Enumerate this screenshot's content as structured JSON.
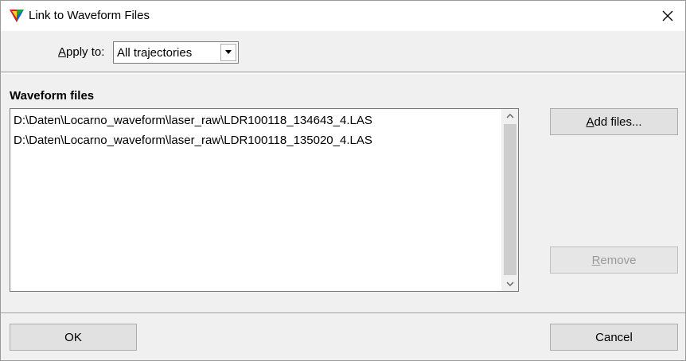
{
  "window": {
    "title": "Link to Waveform Files"
  },
  "apply": {
    "label_prefix": "",
    "label_accel": "A",
    "label_rest": "pply to:",
    "selected": "All trajectories"
  },
  "files": {
    "section_label": "Waveform files",
    "items": [
      "D:\\Daten\\Locarno_waveform\\laser_raw\\LDR100118_134643_4.LAS",
      "D:\\Daten\\Locarno_waveform\\laser_raw\\LDR100118_135020_4.LAS"
    ]
  },
  "buttons": {
    "add_accel": "A",
    "add_rest": "dd files...",
    "remove_accel": "R",
    "remove_rest": "emove",
    "ok": "OK",
    "cancel": "Cancel"
  },
  "colors": {
    "window_bg": "#f0f0f0",
    "titlebar_bg": "#ffffff",
    "button_bg": "#e1e1e1"
  },
  "icons": {
    "app": "terrasolid-tri-icon",
    "close": "close-icon",
    "dropdown": "triangle-down-icon",
    "scroll_up": "chevron-up-icon",
    "scroll_down": "chevron-down-icon"
  }
}
